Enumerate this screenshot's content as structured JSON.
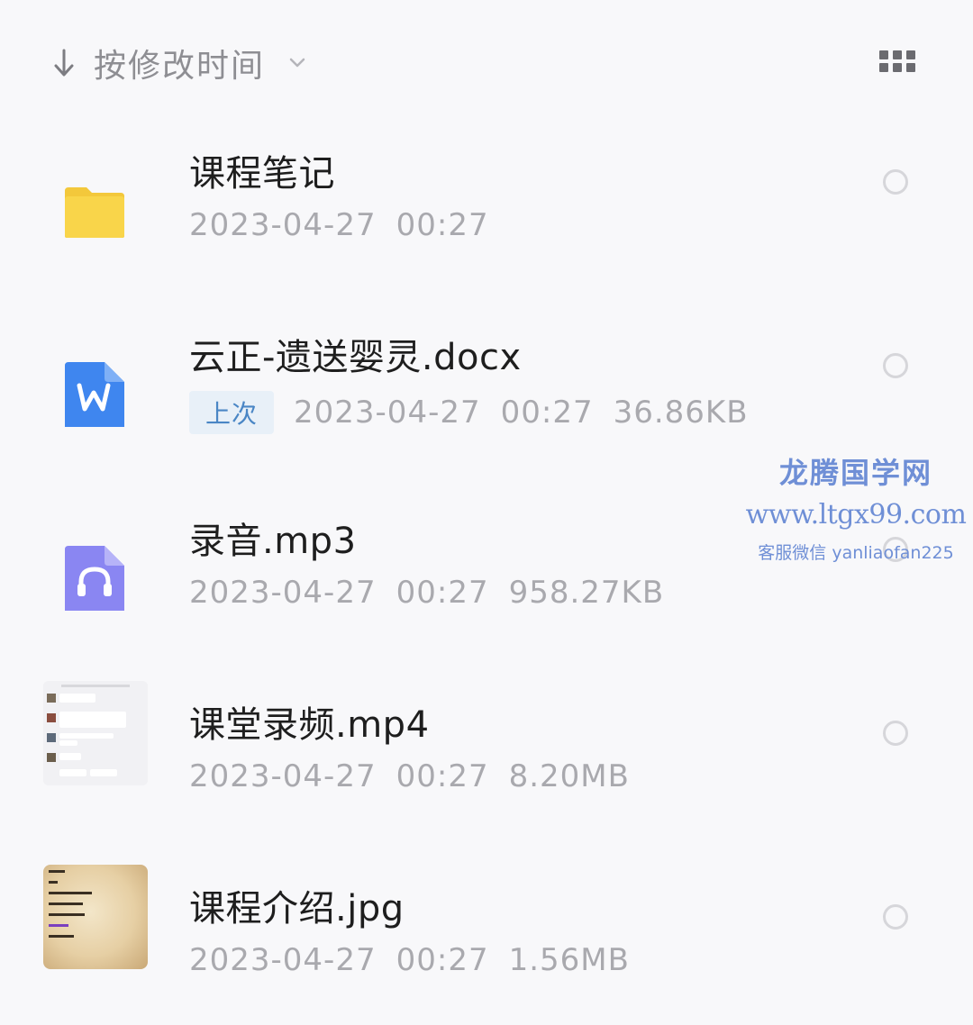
{
  "sort": {
    "label": "按修改时间",
    "arrow_icon": "arrow-down-icon",
    "chevron_icon": "chevron-down-icon"
  },
  "view_toggle": {
    "icon": "grid-view-icon"
  },
  "files": [
    {
      "name": "课程笔记",
      "date": "2023-04-27",
      "time": "00:27",
      "size": "",
      "badge": "",
      "icon": "folder-icon",
      "icon_color": "#f9d54a"
    },
    {
      "name": "云正-遗送婴灵.docx",
      "date": "2023-04-27",
      "time": "00:27",
      "size": "36.86KB",
      "badge": "上次",
      "icon": "word-doc-icon",
      "icon_color": "#3f86ef"
    },
    {
      "name": "录音.mp3",
      "date": "2023-04-27",
      "time": "00:27",
      "size": "958.27KB",
      "badge": "",
      "icon": "audio-headphones-icon",
      "icon_color": "#8a86f2"
    },
    {
      "name": "课堂录频.mp4",
      "date": "2023-04-27",
      "time": "00:27",
      "size": "8.20MB",
      "badge": "",
      "icon": "video-thumbnail",
      "icon_color": ""
    },
    {
      "name": "课程介绍.jpg",
      "date": "2023-04-27",
      "time": "00:27",
      "size": "1.56MB",
      "badge": "",
      "icon": "image-thumbnail",
      "icon_color": ""
    }
  ],
  "watermark": {
    "title": "龙腾国学网",
    "url": "www.ltgx99.com",
    "contact": "客服微信 yanliaofan225"
  },
  "colors": {
    "background": "#f8f8fa",
    "text_primary": "#1e1e1e",
    "text_secondary": "#a9a9ae",
    "badge_bg": "#e8f0f8",
    "badge_text": "#4a86c5",
    "watermark": "#6f8fd6"
  }
}
